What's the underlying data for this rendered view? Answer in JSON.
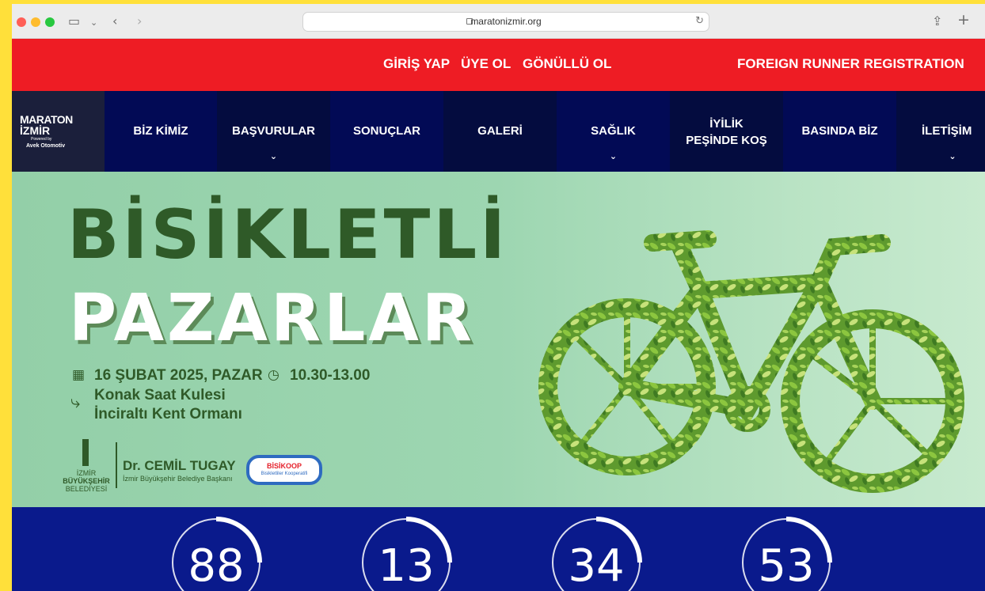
{
  "browser": {
    "url": "maratonizmir.org"
  },
  "topbar": {
    "login": "GİRİŞ YAP",
    "signup": "ÜYE OL",
    "volunteer": "GÖNÜLLÜ OL",
    "foreign": "FOREIGN RUNNER REGISTRATION",
    "bg_color": "#EE1C24"
  },
  "logo": {
    "line1": "MARATON",
    "line2": "İZMİR",
    "powered": "Powered by",
    "sponsor": "Avek Otomotiv"
  },
  "nav": {
    "items": [
      {
        "label": "BİZ KİMİZ",
        "dropdown": false
      },
      {
        "label": "BAŞVURULAR",
        "dropdown": true
      },
      {
        "label": "SONUÇLAR",
        "dropdown": false
      },
      {
        "label": "GALERİ",
        "dropdown": false
      },
      {
        "label": "SAĞLIK",
        "dropdown": true
      },
      {
        "label": "İYİLİK PEŞİNDE KOŞ",
        "dropdown": false
      },
      {
        "label": "BASINDA BİZ",
        "dropdown": false
      },
      {
        "label": "İLETİŞİM",
        "dropdown": true
      }
    ],
    "colors": [
      "#020A55",
      "#040C3F"
    ]
  },
  "hero": {
    "title_line1": "BİSİKLETLİ",
    "title_line2": "PAZARLAR",
    "date": "16 ŞUBAT 2025, PAZAR",
    "time": "10.30-13.00",
    "route_from": "Konak Saat Kulesi",
    "route_to": "İnciraltı Kent Ormanı",
    "municipality_line1": "İZMİR",
    "municipality_line2": "BÜYÜKŞEHİR",
    "municipality_line3": "BELEDİYESİ",
    "mayor_name": "Dr. CEMİL TUGAY",
    "mayor_title": "İzmir Büyükşehir Belediye Başkanı",
    "partner_name": "BİSİKOOP",
    "partner_sub": "Bisikletliler Kooperatifi"
  },
  "counters": {
    "values": [
      "88",
      "13",
      "34",
      "53"
    ],
    "bg_color": "#0A1A8C"
  }
}
